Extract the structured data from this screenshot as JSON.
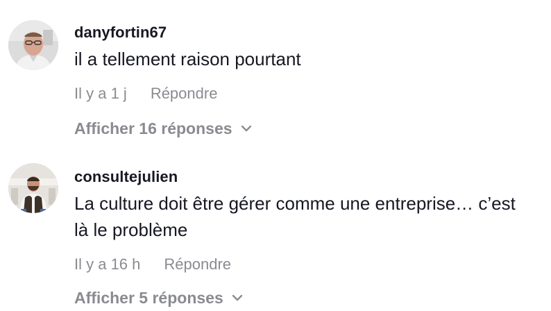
{
  "comments": [
    {
      "username": "danyfortin67",
      "text": "il a tellement raison pourtant",
      "time": "Il y a 1 j",
      "reply_label": "Répondre",
      "replies_label": "Afficher 16 réponses"
    },
    {
      "username": "consultejulien",
      "text": "La culture doit être gérer comme une entreprise… c’est là le problème",
      "time": "Il y a 16 h",
      "reply_label": "Répondre",
      "replies_label": "Afficher 5 réponses"
    }
  ],
  "colors": {
    "primary_text": "#161823",
    "secondary_text": "#8a8b91",
    "background": "#ffffff"
  },
  "icons": {
    "expand": "chevron-down-icon"
  }
}
